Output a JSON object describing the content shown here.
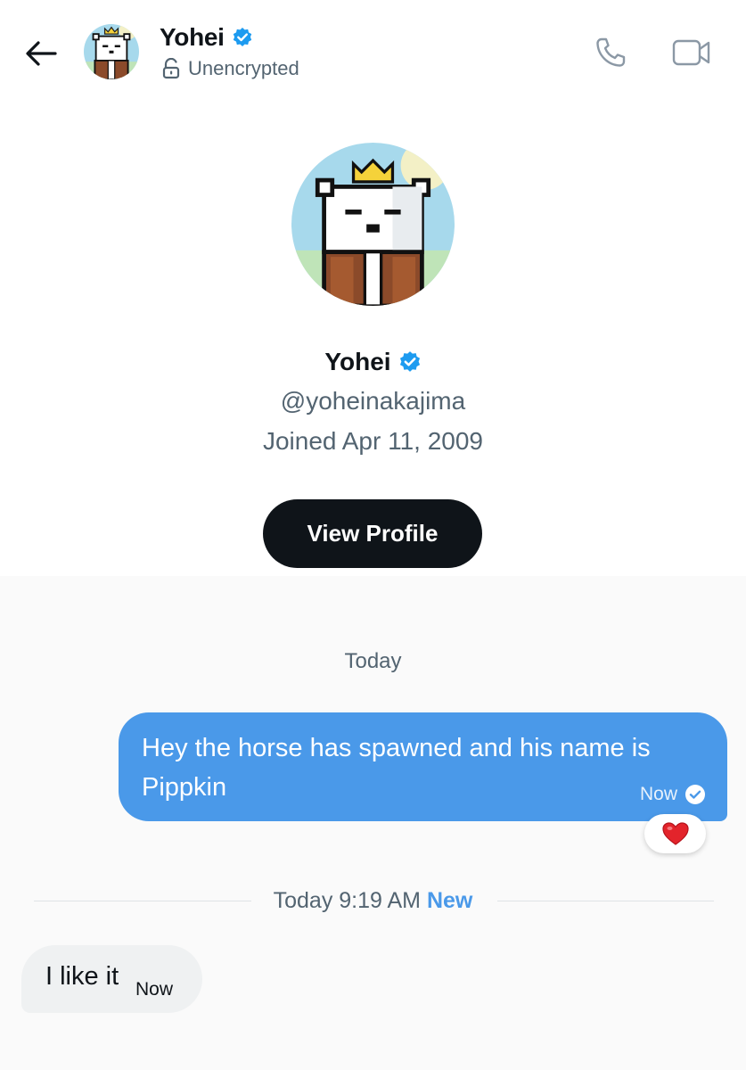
{
  "header": {
    "name": "Yohei",
    "encryption_status": "Unencrypted",
    "icons": {
      "back": "arrow-left-icon",
      "verified": "verified-badge-icon",
      "lock": "lock-open-icon",
      "call": "phone-icon",
      "video": "video-camera-icon"
    }
  },
  "profile": {
    "name": "Yohei",
    "handle": "@yoheinakajima",
    "joined": "Joined Apr 11, 2009",
    "view_profile_label": "View Profile"
  },
  "conversation": {
    "day_label": "Today",
    "messages": [
      {
        "direction": "outgoing",
        "text": "Hey the horse has spawned and his name is Pippkin",
        "time": "Now",
        "status": "read",
        "reaction": "❤️"
      },
      {
        "direction": "incoming",
        "text": "I like it",
        "time": "Now"
      }
    ],
    "divider": {
      "text": "Today 9:19 AM",
      "badge": "New"
    }
  },
  "colors": {
    "accent": "#4a99e9",
    "verified": "#1d9bf0",
    "primary_button": "#0f1419",
    "muted_text": "#536471",
    "incoming_bubble": "#eff1f2"
  }
}
